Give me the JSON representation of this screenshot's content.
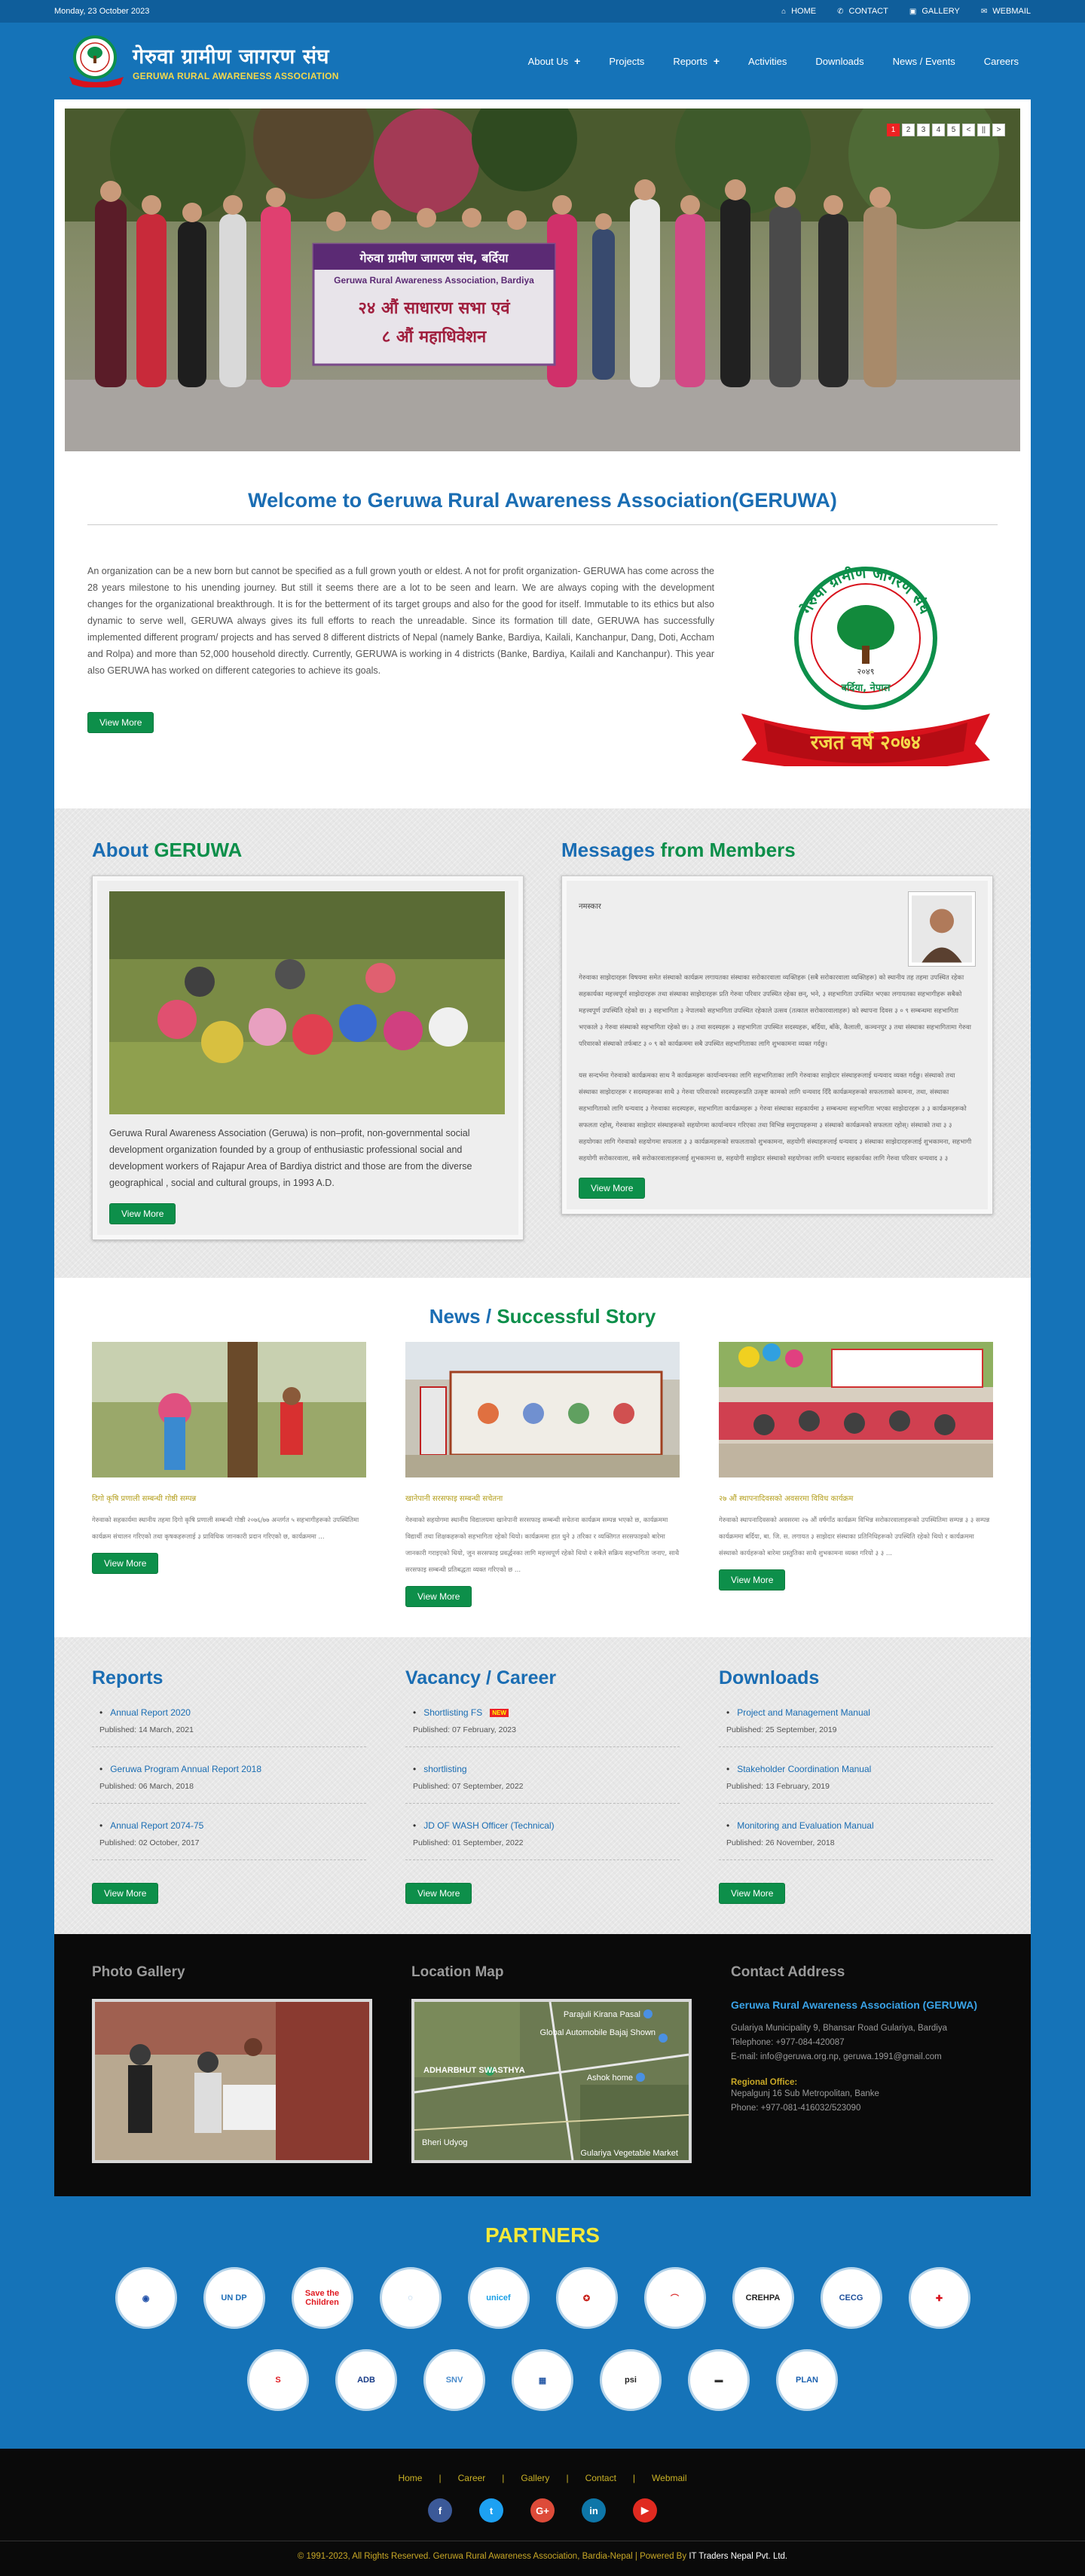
{
  "topbar": {
    "date": "Monday, 23 October 2023",
    "links": [
      {
        "icon": "home-icon",
        "glyph": "⌂",
        "label": "HOME"
      },
      {
        "icon": "phone-icon",
        "glyph": "✆",
        "label": "CONTACT"
      },
      {
        "icon": "gallery-icon",
        "glyph": "▣",
        "label": "GALLERY"
      },
      {
        "icon": "mail-icon",
        "glyph": "✉",
        "label": "WEBMAIL"
      }
    ]
  },
  "brand": {
    "name_np": "गेरुवा ग्रामीण जागरण संघ",
    "name_en": "GERUWA RURAL AWARENESS ASSOCIATION"
  },
  "nav": {
    "items": [
      {
        "label": "About Us",
        "has_sub": true
      },
      {
        "label": "Projects",
        "has_sub": false
      },
      {
        "label": "Reports",
        "has_sub": true
      },
      {
        "label": "Activities",
        "has_sub": false
      },
      {
        "label": "Downloads",
        "has_sub": false
      },
      {
        "label": "News / Events",
        "has_sub": false
      },
      {
        "label": "Careers",
        "has_sub": false
      }
    ]
  },
  "slider": {
    "banner_line1": "गेरुवा ग्रामीण जागरण संघ, बर्दिया",
    "banner_line2": "Geruwa Rural Awareness Association, Bardiya",
    "banner_line3": "२४ औं साधारण सभा एवं",
    "banner_line4": "८ औं महाधिवेशन",
    "pages": [
      "1",
      "2",
      "3",
      "4",
      "5",
      "<",
      "||",
      ">"
    ]
  },
  "welcome": {
    "title": "Welcome to Geruwa Rural Awareness Association(GERUWA)",
    "text": "An organization can be a new born but cannot be specified as a full grown youth or eldest. A not for profit organization- GERUWA has come across the 28 years milestone to his unending journey. But still it seems there are a lot to be seen and learn. We are always coping with the development changes for the organizational breakthrough. It is for the betterment of its target groups and also for the good for itself. Immutable to its ethics but also dynamic to serve well, GERUWA always gives its full efforts to reach the unreadable. Since its formation till date, GERUWA has successfully implemented different program/ projects and has served 8 different districts of Nepal (namely Banke, Bardiya, Kailali, Kanchanpur, Dang, Doti, Accham and Rolpa) and more than 52,000 household directly. Currently, GERUWA is working in 4 districts (Banke, Bardiya, Kailali and Kanchanpur). This year also GERUWA has worked on different categories to achieve its goals.",
    "button": "View More",
    "emblem_top": "गेरुवा ग्रामीण जागरण संघ",
    "emblem_bottom": "बर्दिया, नेपाल",
    "emblem_year": "२०४९",
    "ribbon": "रजत वर्ष २०७४"
  },
  "about": {
    "title_a": "About",
    "title_b": "GERUWA",
    "text": "Geruwa Rural Awareness Association (Geruwa) is non–profit, non-governmental social development organization founded by a group of enthusiastic professional social and development workers of Rajapur Area of Bardiya district and those are from the diverse geographical , social and cultural groups, in 1993 A.D.",
    "button": "View More"
  },
  "messages": {
    "title_a": "Messages",
    "title_b": "from Members",
    "salutation": "नमस्कार",
    "para1": "गेरुवाका साझेदारहरू विषयमा समेत संस्थाको कार्यक्रम लगायतका संस्थाका सरोकारवाला व्यक्तिहरू (सबै सरोकारवाला व्यक्तिहरू) को स्थानीय तह तहमा उपस्थित रहेका सहकार्यका महत्त्वपूर्ण साझेदारहरू तथा संस्थाका साझेदारहरू प्रति गेरुवा परिवार उपस्थित रहेका छन्, भने, ३ सहभागिता उपस्थित भएका लगायतका सहभागीहरू सबैको महत्त्वपूर्ण उपस्थिति रहेको छ। ३ सहभागिता ३ नेपालको सहभागिता उपस्थित रहेकाले उत्सव (तत्काल सरोकारवालाहरू) को स्थापना दिवस ३ ० ९ सम्बन्धमा सहभागिता भएकाले ३ गेरुवा संस्थाको सहभागिता रहेको छ। ३ तथा सदस्यहरू ३ सहभागिता उपस्थित सदस्यहरू, बर्दिया, बाँके, कैलाली, कञ्चनपुर ३ तथा संस्थाका सहभागितामा गेरुवा परिवारको संस्थाको तर्फबाट ३ ० ९ को कार्यक्रममा सबै उपस्थित सहभागिताका लागि शुभकामना व्यक्त गर्दछु।",
    "para2": "यस सन्दर्भमा गेरुवाको कार्यक्रमका साथ नै कार्यक्रमहरू कार्यान्वयनका लागि सहभागिताका लागि गेरुवाका साझेदार संस्थाहरूलाई धन्यवाद व्यक्त गर्दछु। संस्थाको तथा संस्थाका साझेदारहरू र सदस्यहरूका साथै ३ गेरुवा परिवारको सदस्यहरूप्रति उत्कृष्ट कामको लागि धन्यवाद दिँदै कार्यक्रमहरूको सफलताको कामना, तथा, संस्थाका सहभागिताको लागि धन्यवाद ३ गेरुवाका सदस्यहरू, सहभागिता कार्यक्रमहरू ३ गेरुवा संस्थाका सहकार्यमा ३ सम्बन्धमा सहभागिता भएका साझेदारहरू ३ ३ कार्यक्रमहरूको सफलता रहोस्, गेरुवाका साझेदार संस्थाहरूको सहयोगमा कार्यान्वयन गरिएका तथा विभिन्न समुदायहरूमा ३ संस्थाको कार्यक्रमको सफलता रहोस्। संस्थाको तथा ३ ३ सहयोगका लागि गेरुवाको सहयोगमा सफलता ३ ३ कार्यक्रमहरूको सफलताको शुभकामना, सहयोगी संस्थाहरूलाई धन्यवाद ३ संस्थाका साझेदारहरूलाई शुभकामना, सहभागी सहयोगी सरोकारवाला, सबै सरोकारवालाहरूलाई शुभकामना छ, सहयोगी साझेदार संस्थाको सहयोगका लागि धन्यवाद सहकार्यका लागि गेरुवा परिवार धन्यवाद ३ ३",
    "button": "View More"
  },
  "news": {
    "title_a": "News /",
    "title_b": "Successful Story",
    "items": [
      {
        "title": "दिगो कृषि प्रणाली सम्बन्धी गोष्ठी सम्पन्न",
        "text": "गेरुवाको सहकार्यमा स्थानीय तहमा दिगो कृषि प्रणाली सम्बन्धी गोष्ठी २०७६/७७ अन्तर्गत ५ सहभागीहरूको उपस्थितिमा कार्यक्रम संचालन गरिएको तथा कृषकहरूलाई ३ प्राविधिक जानकारी प्रदान गरिएको छ, कार्यक्रममा ...",
        "button": "View More"
      },
      {
        "title": "खानेपानी सरसफाइ सम्बन्धी सचेतना",
        "text": "गेरुवाको सहयोगमा स्थानीय विद्यालयमा खानेपानी सरसफाइ सम्बन्धी सचेतना कार्यक्रम सम्पन्न भएको छ, कार्यक्रममा विद्यार्थी तथा शिक्षकहरूको सहभागिता रहेको थियो। कार्यक्रममा हात धुने ३ तरिका र व्यक्तिगत सरसफाइको बारेमा जानकारी गराइएको थियो, जुन सरसफाइ प्रवर्द्धनका लागि महत्त्वपूर्ण रहेको थियो र सबैले सक्रिय सहभागिता जनाए, साथै सरसफाइ सम्बन्धी प्रतिबद्धता व्यक्त गरिएको छ ...",
        "button": "View More"
      },
      {
        "title": "२७ औं स्थापनादिवसको अवसरमा विविध कार्यक्रम",
        "text": "गेरुवाको स्थापनादिवसको अवसरमा २७ औं वर्षगाँठ कार्यक्रम विभिन्न सरोकारवालाहरूको उपस्थितिमा सम्पन्न ३ ३ सम्पन्न कार्यक्रममा बर्दिया, बा. जि. स. लगायत ३ साझेदार संस्थाका प्रतिनिधिहरूको उपस्थिति रहेको थियो र कार्यक्रममा संस्थाको कार्यहरूको बारेमा प्रस्तुतिका साथै शुभकामना व्यक्त गरियो ३ ३ ...",
        "button": "View More"
      }
    ]
  },
  "reports": {
    "title": "Reports",
    "items": [
      {
        "label": "Annual Report 2020",
        "date": "Published: 14 March, 2021"
      },
      {
        "label": "Geruwa Program Annual Report 2018",
        "date": "Published: 06 March, 2018"
      },
      {
        "label": "Annual Report 2074-75",
        "date": "Published: 02 October, 2017"
      }
    ],
    "button": "View More"
  },
  "vacancy": {
    "title": "Vacancy / Career",
    "badge": "NEW",
    "items": [
      {
        "label": "Shortlisting FS",
        "date": "Published: 07 February, 2023"
      },
      {
        "label": "shortlisting",
        "date": "Published: 07 September, 2022"
      },
      {
        "label": "JD OF WASH Officer (Technical)",
        "date": "Published: 01 September, 2022"
      }
    ],
    "button": "View More"
  },
  "downloads": {
    "title": "Downloads",
    "items": [
      {
        "label": "Project and Management Manual",
        "date": "Published: 25 September, 2019"
      },
      {
        "label": "Stakeholder Coordination Manual",
        "date": "Published: 13 February, 2019"
      },
      {
        "label": "Monitoring and Evaluation Manual",
        "date": "Published: 26 November, 2018"
      }
    ],
    "button": "View More"
  },
  "footer": {
    "gallery_title": "Photo Gallery",
    "map_title": "Location Map",
    "map_labels": [
      "Parajuli Kirana Pasal",
      "Global Automobile Bajaj Shown",
      "ADHARBHUT SWASTHYA",
      "Ashok home",
      "Bheri Udyog",
      "Gulariya Vegetable Market"
    ],
    "contact_title": "Contact Address",
    "org": "Geruwa Rural Awareness Association (GERUWA)",
    "address": "Gulariya Municipality 9, Bhansar Road Gulariya, Bardiya",
    "phone": "Telephone: +977-084-420087",
    "email": "E-mail: info@geruwa.org.np, geruwa.1991@gmail.com",
    "regional_title": "Regional Office:",
    "regional_address": "Nepalgunj 16 Sub Metropolitan, Banke",
    "regional_phone": "Phone: +977-081-416032/523090"
  },
  "partners": {
    "title": "PARTNERS",
    "logos": [
      {
        "name": "seal-logo",
        "text": "◉",
        "color": "#1e4fa8"
      },
      {
        "name": "undp-logo",
        "text": "UN DP",
        "color": "#1f6fb8"
      },
      {
        "name": "save-the-children-logo",
        "text": "Save the Children",
        "color": "#e01b22"
      },
      {
        "name": "partner-logo-4",
        "text": "◌",
        "color": "#6aa6d8"
      },
      {
        "name": "unicef-logo",
        "text": "unicef",
        "color": "#1ca0e6"
      },
      {
        "name": "nepal-government-logo",
        "text": "✪",
        "color": "#c8221c"
      },
      {
        "name": "partner-logo-7",
        "text": "⌒",
        "color": "#d33"
      },
      {
        "name": "crehpa-logo",
        "text": "CREHPA",
        "color": "#222"
      },
      {
        "name": "cecg-logo",
        "text": "CECG",
        "color": "#1d4f9b"
      },
      {
        "name": "caritas-logo",
        "text": "✚",
        "color": "#d8121c"
      },
      {
        "name": "partner-logo-11",
        "text": "S",
        "color": "#e01b22"
      },
      {
        "name": "adb-logo",
        "text": "ADB",
        "color": "#163a86"
      },
      {
        "name": "snv-logo",
        "text": "SNV",
        "color": "#4a8ccc"
      },
      {
        "name": "partner-logo-14",
        "text": "▦",
        "color": "#2a5ca8"
      },
      {
        "name": "psi-logo",
        "text": "psi",
        "color": "#222"
      },
      {
        "name": "partner-logo-16",
        "text": "▬",
        "color": "#333"
      },
      {
        "name": "plan-logo",
        "text": "PLAN",
        "color": "#1c62b0"
      }
    ]
  },
  "bottom": {
    "links": [
      "Home",
      "Career",
      "Gallery",
      "Contact",
      "Webmail"
    ],
    "separator": "|",
    "social": [
      {
        "name": "facebook-icon",
        "glyph": "f",
        "color": "#3b5998"
      },
      {
        "name": "twitter-icon",
        "glyph": "t",
        "color": "#1da1f2"
      },
      {
        "name": "google-plus-icon",
        "glyph": "G+",
        "color": "#dd4b39"
      },
      {
        "name": "linkedin-icon",
        "glyph": "in",
        "color": "#0e76a8"
      },
      {
        "name": "youtube-icon",
        "glyph": "▶",
        "color": "#e02a20"
      }
    ],
    "copyright": "© 1991-2023, All Rights Reserved. Geruwa Rural Awareness Association, Bardia-Nepal | Powered By",
    "powered": "IT Traders Nepal Pvt. Ltd."
  }
}
